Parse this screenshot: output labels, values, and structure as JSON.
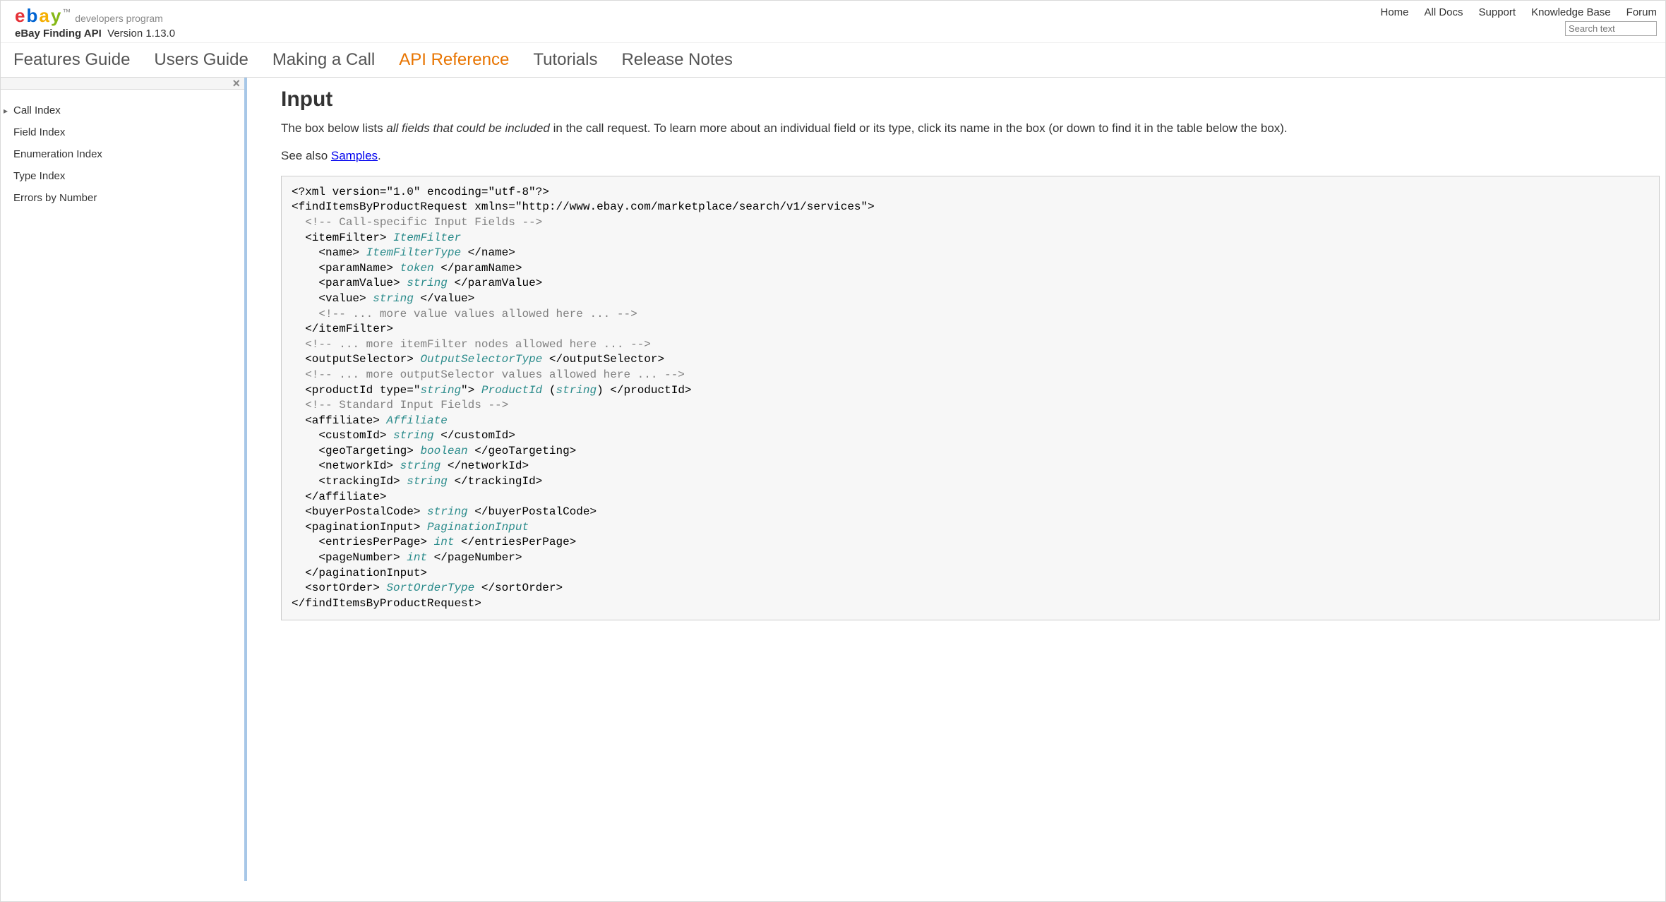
{
  "brand": {
    "logo_letters": [
      "e",
      "b",
      "a",
      "y"
    ],
    "logo_sub": "developers program",
    "api_name": "eBay Finding API",
    "version_label": "Version 1.13.0"
  },
  "top_links": [
    "Home",
    "All Docs",
    "Support",
    "Knowledge Base",
    "Forum"
  ],
  "search_placeholder": "Search text",
  "nav_tabs": [
    {
      "label": "Features Guide",
      "active": false
    },
    {
      "label": "Users Guide",
      "active": false
    },
    {
      "label": "Making a Call",
      "active": false
    },
    {
      "label": "API Reference",
      "active": true
    },
    {
      "label": "Tutorials",
      "active": false
    },
    {
      "label": "Release Notes",
      "active": false
    }
  ],
  "sidebar": {
    "items": [
      {
        "label": "Call Index",
        "caret": true
      },
      {
        "label": "Field Index",
        "caret": false
      },
      {
        "label": "Enumeration Index",
        "caret": false
      },
      {
        "label": "Type Index",
        "caret": false
      },
      {
        "label": "Errors by Number",
        "caret": false
      }
    ]
  },
  "main": {
    "heading": "Input",
    "para_prefix": "The box below lists ",
    "para_em": "all fields that could be included",
    "para_suffix": " in the call request. To learn more about an individual field or its type, click its name in the box (or down to find it in the table below the box).",
    "seealso_prefix": "See also ",
    "seealso_link": "Samples",
    "seealso_suffix": "."
  },
  "code": {
    "lines": [
      [
        {
          "t": "<?xml version=\"1.0\" encoding=\"utf-8\"?>",
          "c": "black"
        }
      ],
      [
        {
          "t": "<findItemsByProductRequest xmlns=\"http://www.ebay.com/marketplace/search/v1/services\">",
          "c": "black"
        }
      ],
      [
        {
          "t": "  <!-- Call-specific Input Fields -->",
          "c": "comment"
        }
      ],
      [
        {
          "t": "  <itemFilter> ",
          "c": "black"
        },
        {
          "t": "ItemFilter",
          "c": "type"
        }
      ],
      [
        {
          "t": "    <name> ",
          "c": "black"
        },
        {
          "t": "ItemFilterType",
          "c": "type"
        },
        {
          "t": " </name>",
          "c": "black"
        }
      ],
      [
        {
          "t": "    <paramName> ",
          "c": "black"
        },
        {
          "t": "token",
          "c": "type"
        },
        {
          "t": " </paramName>",
          "c": "black"
        }
      ],
      [
        {
          "t": "    <paramValue> ",
          "c": "black"
        },
        {
          "t": "string",
          "c": "type"
        },
        {
          "t": " </paramValue>",
          "c": "black"
        }
      ],
      [
        {
          "t": "    <value> ",
          "c": "black"
        },
        {
          "t": "string",
          "c": "type"
        },
        {
          "t": " </value>",
          "c": "black"
        }
      ],
      [
        {
          "t": "    <!-- ... more value values allowed here ... -->",
          "c": "comment"
        }
      ],
      [
        {
          "t": "  </itemFilter>",
          "c": "black"
        }
      ],
      [
        {
          "t": "  <!-- ... more itemFilter nodes allowed here ... -->",
          "c": "comment"
        }
      ],
      [
        {
          "t": "  <outputSelector> ",
          "c": "black"
        },
        {
          "t": "OutputSelectorType",
          "c": "type"
        },
        {
          "t": " </outputSelector>",
          "c": "black"
        }
      ],
      [
        {
          "t": "  <!-- ... more outputSelector values allowed here ... -->",
          "c": "comment"
        }
      ],
      [
        {
          "t": "  <productId type=\"",
          "c": "black"
        },
        {
          "t": "string",
          "c": "type"
        },
        {
          "t": "\"> ",
          "c": "black"
        },
        {
          "t": "ProductId",
          "c": "type"
        },
        {
          "t": " (",
          "c": "black"
        },
        {
          "t": "string",
          "c": "type"
        },
        {
          "t": ") </productId>",
          "c": "black"
        }
      ],
      [
        {
          "t": "  <!-- Standard Input Fields -->",
          "c": "comment"
        }
      ],
      [
        {
          "t": "  <affiliate> ",
          "c": "black"
        },
        {
          "t": "Affiliate",
          "c": "type"
        }
      ],
      [
        {
          "t": "    <customId> ",
          "c": "black"
        },
        {
          "t": "string",
          "c": "type"
        },
        {
          "t": " </customId>",
          "c": "black"
        }
      ],
      [
        {
          "t": "    <geoTargeting> ",
          "c": "black"
        },
        {
          "t": "boolean",
          "c": "type"
        },
        {
          "t": " </geoTargeting>",
          "c": "black"
        }
      ],
      [
        {
          "t": "    <networkId> ",
          "c": "black"
        },
        {
          "t": "string",
          "c": "type"
        },
        {
          "t": " </networkId>",
          "c": "black"
        }
      ],
      [
        {
          "t": "    <trackingId> ",
          "c": "black"
        },
        {
          "t": "string",
          "c": "type"
        },
        {
          "t": " </trackingId>",
          "c": "black"
        }
      ],
      [
        {
          "t": "  </affiliate>",
          "c": "black"
        }
      ],
      [
        {
          "t": "  <buyerPostalCode> ",
          "c": "black"
        },
        {
          "t": "string",
          "c": "type"
        },
        {
          "t": " </buyerPostalCode>",
          "c": "black"
        }
      ],
      [
        {
          "t": "  <paginationInput> ",
          "c": "black"
        },
        {
          "t": "PaginationInput",
          "c": "type"
        }
      ],
      [
        {
          "t": "    <entriesPerPage> ",
          "c": "black"
        },
        {
          "t": "int",
          "c": "type"
        },
        {
          "t": " </entriesPerPage>",
          "c": "black"
        }
      ],
      [
        {
          "t": "    <pageNumber> ",
          "c": "black"
        },
        {
          "t": "int",
          "c": "type"
        },
        {
          "t": " </pageNumber>",
          "c": "black"
        }
      ],
      [
        {
          "t": "  </paginationInput>",
          "c": "black"
        }
      ],
      [
        {
          "t": "  <sortOrder> ",
          "c": "black"
        },
        {
          "t": "SortOrderType",
          "c": "type"
        },
        {
          "t": " </sortOrder>",
          "c": "black"
        }
      ],
      [
        {
          "t": "</findItemsByProductRequest>",
          "c": "black"
        }
      ]
    ]
  }
}
